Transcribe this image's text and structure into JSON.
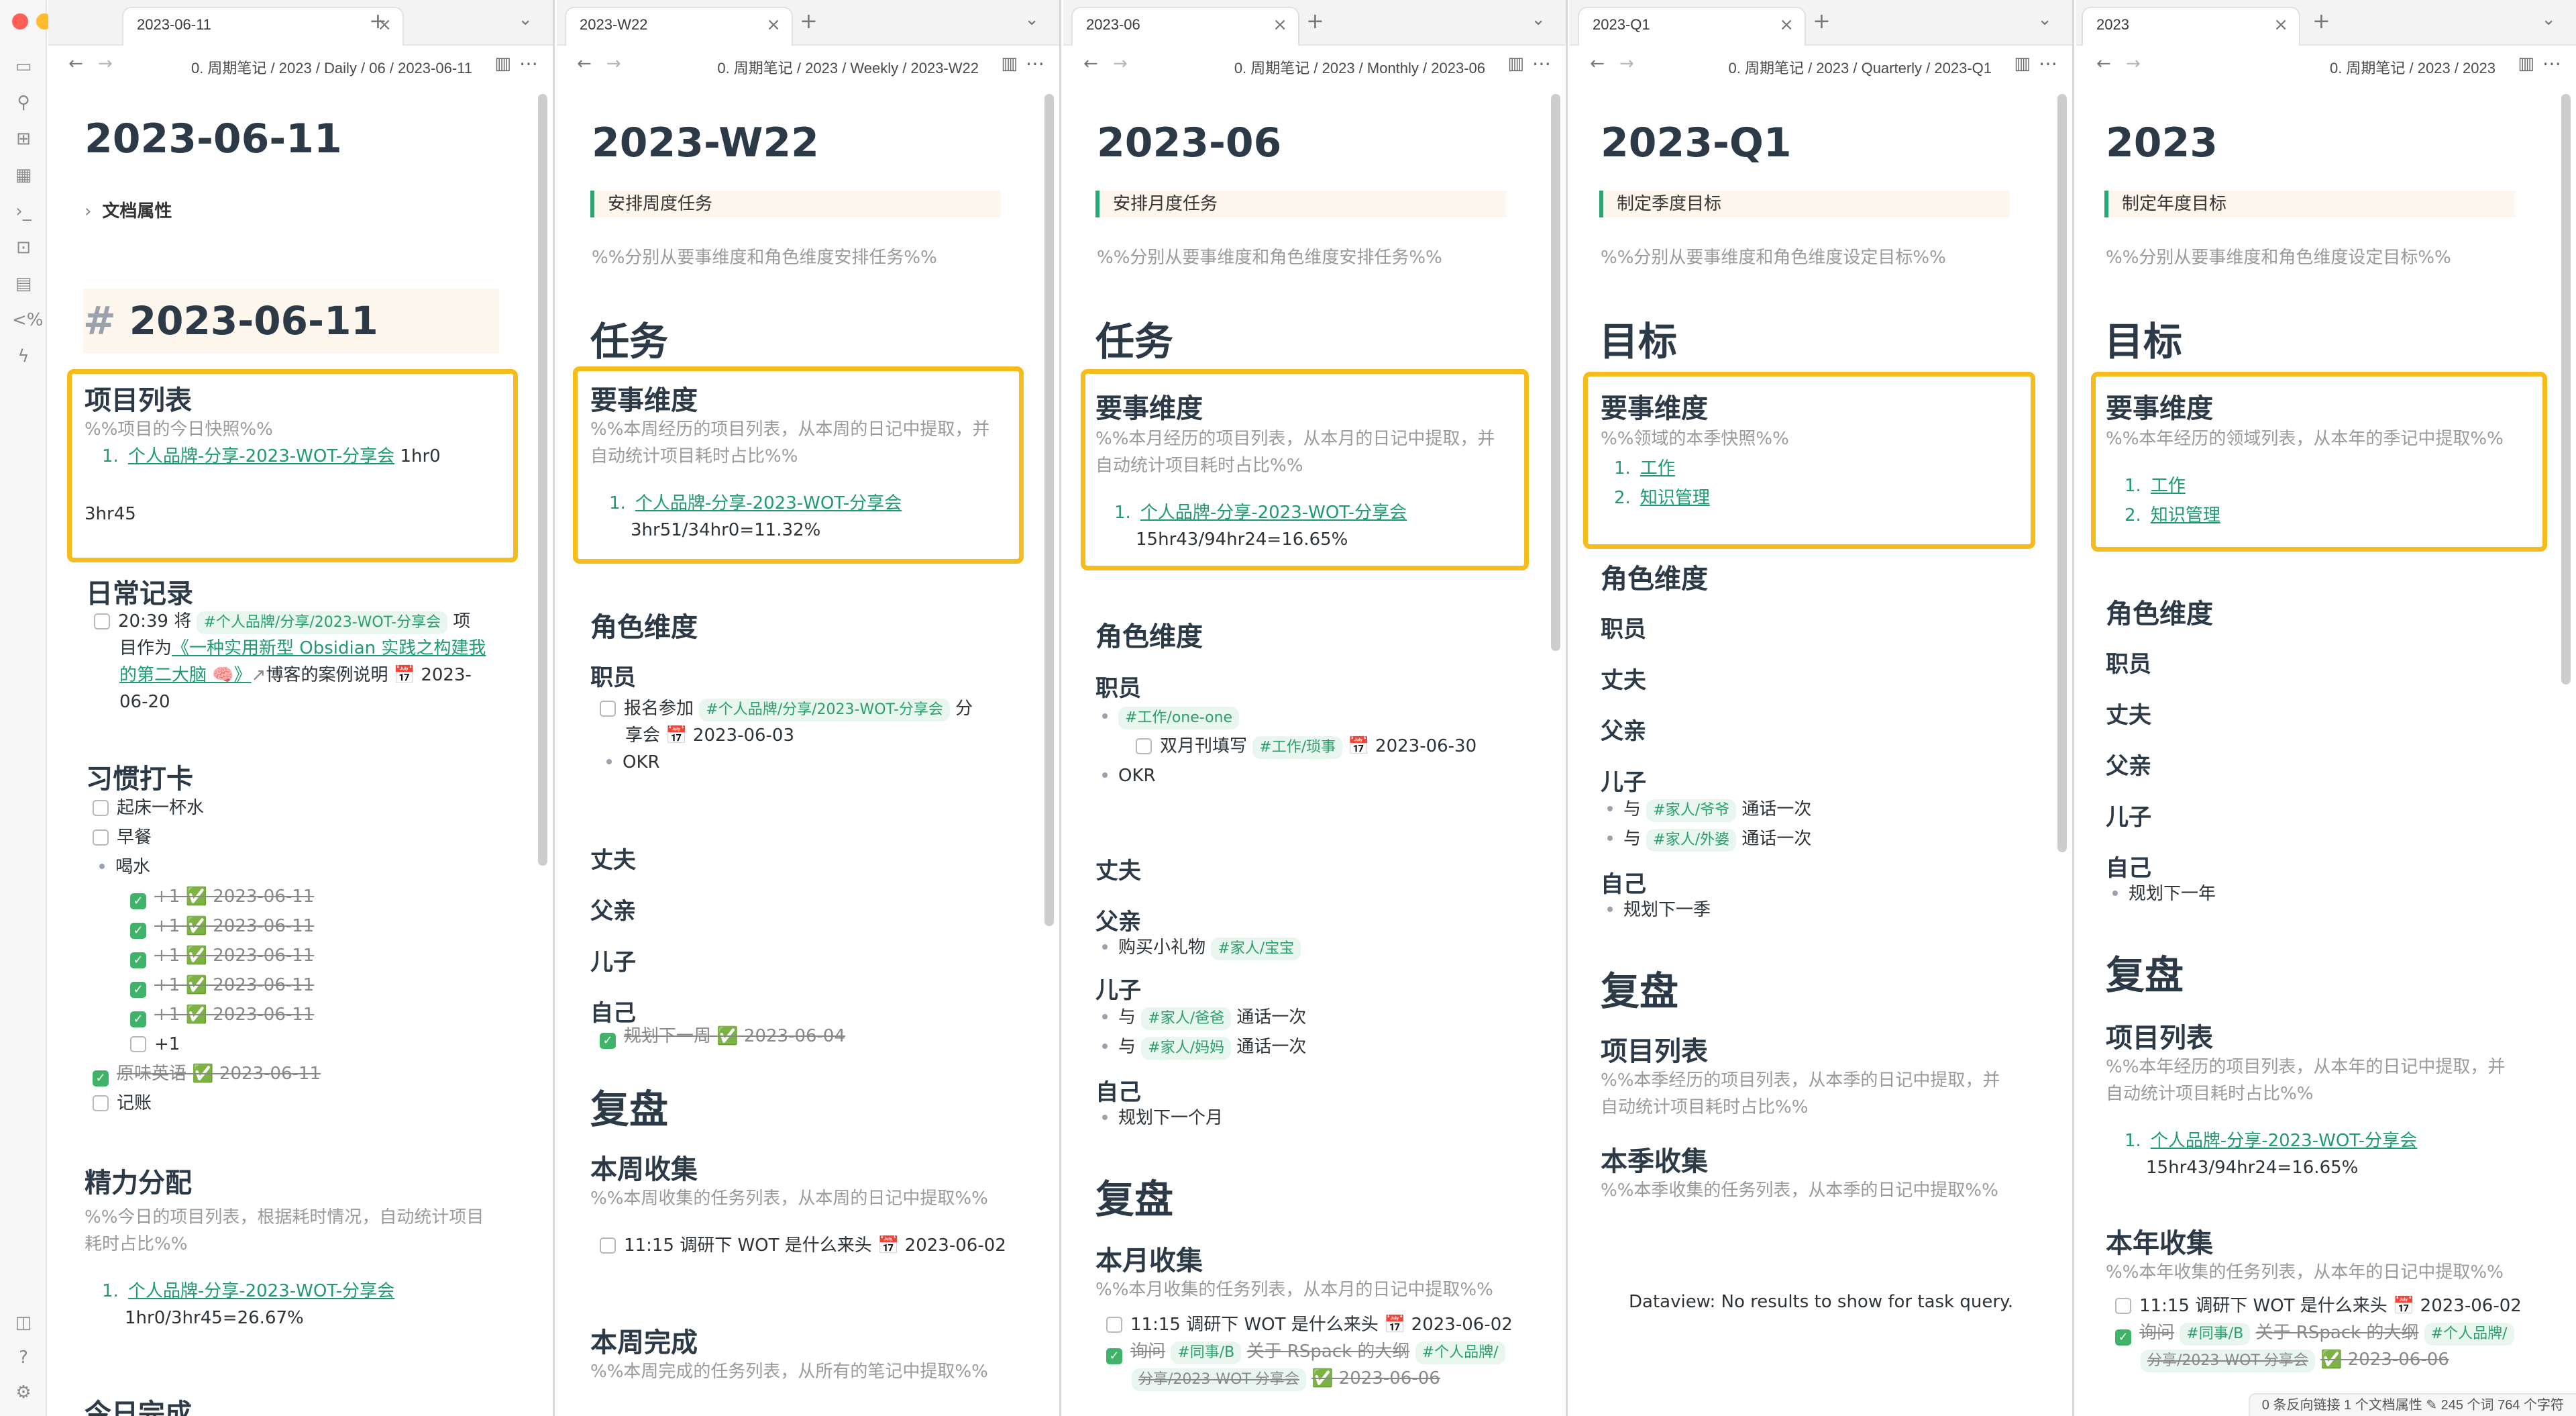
{
  "panes": [
    {
      "tab": "2023-06-11",
      "breadcrumb": "0. 周期笔记 / 2023 / Daily / 06 / 2023-06-11",
      "title": "2023-06-11",
      "properties": "文档属性",
      "h1": "2023-06-11",
      "projects": {
        "heading": "项目列表",
        "comment": "%%项目的今日快照%%",
        "item_num": "1.",
        "item_link": "个人品牌-分享-2023-WOT-分享会",
        "item_time": "1hr0",
        "total": "3hr45"
      },
      "daily": {
        "heading": "日常记录",
        "line1_pre": "20:39 将",
        "line1_tag": "#个人品牌/分享/2023-WOT-分享会",
        "line1_post": "项",
        "line2_pre": "目作为",
        "line2_link": "《一种实用新型 Obsidian 实践之构建我",
        "line3_link": "的第二大脑 🧠》",
        "line3_post": "博客的案例说明 📅 2023-",
        "line4": "06-20"
      },
      "habits": {
        "heading": "习惯打卡",
        "items": [
          "起床一杯水",
          "早餐"
        ],
        "drink": "喝水",
        "done_item": "+1 ✅ 2023-06-11",
        "plus": "+1",
        "english": "原味英语 ✅ 2023-06-11",
        "ledger": "记账"
      },
      "energy": {
        "heading": "精力分配",
        "comment1": "%%今日的项目列表，根据耗时情况，自动统计项目",
        "comment2": "耗时占比%%",
        "item_num": "1.",
        "item_link": "个人品牌-分享-2023-WOT-分享会",
        "item_value": "1hr0/3hr45=26.67%"
      },
      "today_done": "今日完成"
    },
    {
      "tab": "2023-W22",
      "breadcrumb": "0. 周期笔记 / 2023 / Weekly / 2023-W22",
      "title": "2023-W22",
      "callout": "安排周度任务",
      "comment": "%%分别从要事维度和角色维度安排任务%%",
      "tasks": "任务",
      "key": {
        "heading": "要事维度",
        "comment1": "%%本周经历的项目列表，从本周的日记中提取，并",
        "comment2": "自动统计项目耗时占比%%",
        "item_num": "1.",
        "item_link": "个人品牌-分享-2023-WOT-分享会",
        "item_value": "3hr51/34hr0=11.32%"
      },
      "roles": {
        "heading": "角色维度",
        "worker": "职员",
        "task1_pre": "报名参加",
        "task1_tag": "#个人品牌/分享/2023-WOT-分享会",
        "task1_post": "分",
        "task1_line2": "享会 📅 2023-06-03",
        "okr": "OKR",
        "husband": "丈夫",
        "father": "父亲",
        "son": "儿子",
        "self": "自己",
        "self_task": "规划下一周 ✅ 2023-06-04"
      },
      "review": "复盘",
      "collect": {
        "heading": "本周收集",
        "comment": "%%本周收集的任务列表，从本周的日记中提取%%",
        "task": "11:15 调研下 WOT 是什么来头 📅 2023-06-02"
      },
      "done": {
        "heading": "本周完成",
        "comment": "%%本周完成的任务列表，从所有的笔记中提取%%"
      }
    },
    {
      "tab": "2023-06",
      "breadcrumb": "0. 周期笔记 / 2023 / Monthly / 2023-06",
      "title": "2023-06",
      "callout": "安排月度任务",
      "comment": "%%分别从要事维度和角色维度安排任务%%",
      "tasks": "任务",
      "key": {
        "heading": "要事维度",
        "comment1": "%%本月经历的项目列表，从本月的日记中提取，并",
        "comment2": "自动统计项目耗时占比%%",
        "item_num": "1.",
        "item_link": "个人品牌-分享-2023-WOT-分享会",
        "item_value": "15hr43/94hr24=16.65%"
      },
      "roles": {
        "heading": "角色维度",
        "worker": "职员",
        "tag1": "#工作/one-one",
        "sub_task_pre": "双月刊填写",
        "sub_task_tag": "#工作/琐事",
        "sub_task_post": "📅 2023-06-30",
        "okr": "OKR",
        "husband": "丈夫",
        "father": "父亲",
        "father_pre": "购买小礼物",
        "father_tag": "#家人/宝宝",
        "son": "儿子",
        "son1_pre": "与",
        "son1_tag": "#家人/爸爸",
        "son1_post": "通话一次",
        "son2_pre": "与",
        "son2_tag": "#家人/妈妈",
        "son2_post": "通话一次",
        "self": "自己",
        "self_item": "规划下一个月"
      },
      "review": "复盘",
      "collect": {
        "heading": "本月收集",
        "comment": "%%本月收集的任务列表，从本月的日记中提取%%",
        "task1": "11:15 调研下 WOT 是什么来头 📅 2023-06-02",
        "task2_pre": "询问",
        "task2_tag1": "#同事/B",
        "task2_mid": "关于 RSpack 的大纲",
        "task2_tag2": "#个人品牌/",
        "task2_line2": "分享/2023-WOT-分享会",
        "task2_date": "✅ 2023-06-06"
      }
    },
    {
      "tab": "2023-Q1",
      "breadcrumb": "0. 周期笔记 / 2023 / Quarterly / 2023-Q1",
      "title": "2023-Q1",
      "callout": "制定季度目标",
      "comment": "%%分别从要事维度和角色维度设定目标%%",
      "goals": "目标",
      "key": {
        "heading": "要事维度",
        "comment": "%%领域的本季快照%%",
        "items": [
          "工作",
          "知识管理"
        ]
      },
      "roles": {
        "heading": "角色维度",
        "worker": "职员",
        "husband": "丈夫",
        "father": "父亲",
        "son": "儿子",
        "son1_pre": "与",
        "son1_tag": "#家人/爷爷",
        "son1_post": "通话一次",
        "son2_pre": "与",
        "son2_tag": "#家人/外婆",
        "son2_post": "通话一次",
        "self": "自己",
        "self_item": "规划下一季"
      },
      "review": "复盘",
      "projects": {
        "heading": "项目列表",
        "comment1": "%%本季经历的项目列表，从本季的日记中提取，并",
        "comment2": "自动统计项目耗时占比%%"
      },
      "collect": {
        "heading": "本季收集",
        "comment": "%%本季收集的任务列表，从本季的日记中提取%%"
      },
      "dataview": "Dataview: No results to show for task query."
    },
    {
      "tab": "2023",
      "breadcrumb": "0. 周期笔记 / 2023 / 2023",
      "title": "2023",
      "callout": "制定年度目标",
      "comment": "%%分别从要事维度和角色维度设定目标%%",
      "goals": "目标",
      "key": {
        "heading": "要事维度",
        "comment": "%%本年经历的领域列表，从本年的季记中提取%%",
        "items": [
          "工作",
          "知识管理"
        ]
      },
      "roles": {
        "heading": "角色维度",
        "worker": "职员",
        "husband": "丈夫",
        "father": "父亲",
        "son": "儿子",
        "self": "自己",
        "self_item": "规划下一年"
      },
      "review": "复盘",
      "projects": {
        "heading": "项目列表",
        "comment1": "%%本年经历的项目列表，从本年的日记中提取，并",
        "comment2": "自动统计项目耗时占比%%",
        "item_num": "1.",
        "item_link": "个人品牌-分享-2023-WOT-分享会",
        "item_value": "15hr43/94hr24=16.65%"
      },
      "collect": {
        "heading": "本年收集",
        "comment": "%%本年收集的任务列表，从本年的日记中提取%%",
        "task1": "11:15 调研下 WOT 是什么来头 📅 2023-06-02",
        "task2_pre": "询问",
        "task2_tag1": "#同事/B",
        "task2_mid": "关于 RSpack 的大纲",
        "task2_tag2": "#个人品牌/",
        "task2_line2": "分享/2023-WOT-分享会",
        "task2_date": "✅ 2023-06-06"
      },
      "status": "0 条反向链接    1 个文档属性    ✎    245 个词    764 个字符"
    }
  ],
  "colors": {
    "highlight": "#f5bc1c",
    "link": "#1f9a73",
    "tag_bg": "#e9f6ef",
    "check": "#3fb36a"
  },
  "icons": [
    "files-icon",
    "graph-icon",
    "canvas-icon",
    "calendar-icon",
    "terminal-icon",
    "template-icon",
    "kanban-icon",
    "percent-icon",
    "bolt-icon",
    "help-icon",
    "settings-icon",
    "vault-icon"
  ]
}
